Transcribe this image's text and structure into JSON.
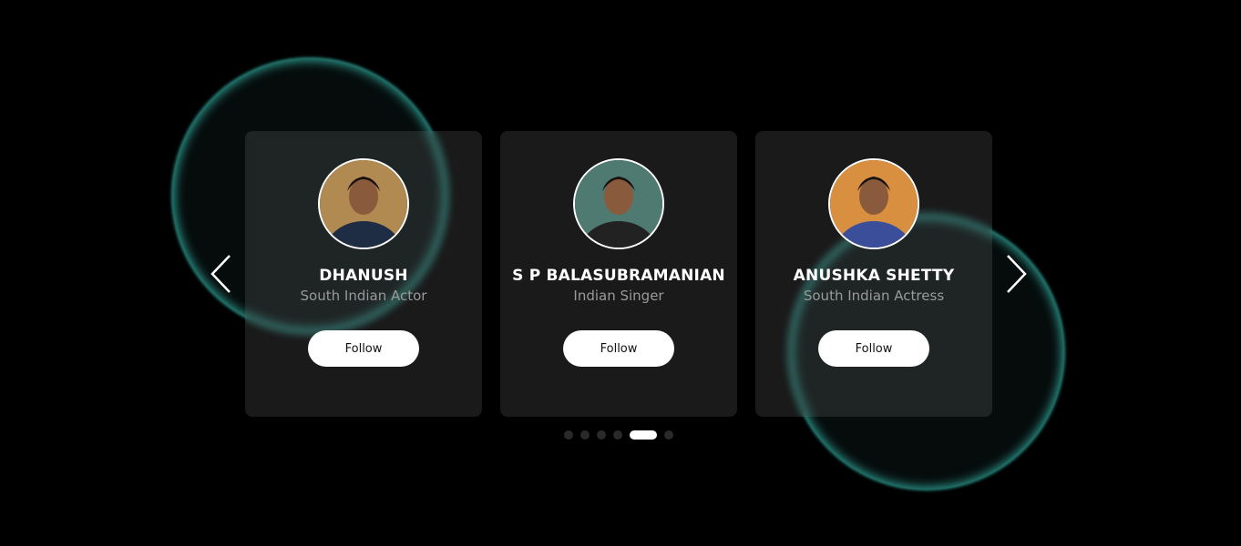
{
  "carousel": {
    "prev_icon": "chevron-left-icon",
    "next_icon": "chevron-right-icon",
    "cards": [
      {
        "name": "DHANUSH",
        "role": "South Indian Actor",
        "follow_label": "Follow",
        "photo_bg": "#b08a50",
        "shirt": "#1e2c44"
      },
      {
        "name": "S P BALASUBRAMANIAN",
        "role": "Indian Singer",
        "follow_label": "Follow",
        "photo_bg": "#4f7a72",
        "shirt": "#222"
      },
      {
        "name": "ANUSHKA SHETTY",
        "role": "South Indian Actress",
        "follow_label": "Follow",
        "photo_bg": "#d89040",
        "shirt": "#3a4e9a"
      }
    ],
    "pagination": {
      "total": 6,
      "active_index": 4
    }
  },
  "colors": {
    "accent_glow": "#40e0d0",
    "background": "#000000"
  }
}
